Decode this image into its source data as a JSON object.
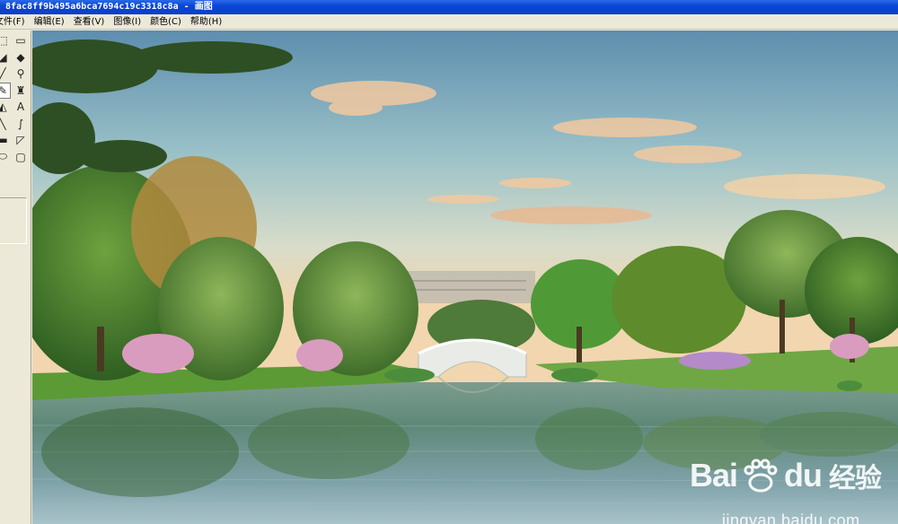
{
  "window": {
    "title": "8fac8ff9b495a6bca7694c19c3318c8a - 画图"
  },
  "menu": [
    {
      "label": "文件(F)"
    },
    {
      "label": "编辑(E)"
    },
    {
      "label": "查看(V)"
    },
    {
      "label": "图像(I)"
    },
    {
      "label": "颜色(C)"
    },
    {
      "label": "帮助(H)"
    }
  ],
  "toolbox": {
    "tools": [
      {
        "name": "free-select-icon",
        "glyph": "⬚"
      },
      {
        "name": "rect-select-icon",
        "glyph": "▭"
      },
      {
        "name": "eraser-icon",
        "glyph": "◢"
      },
      {
        "name": "fill-bucket-icon",
        "glyph": "◆"
      },
      {
        "name": "color-picker-icon",
        "glyph": "╱"
      },
      {
        "name": "magnifier-icon",
        "glyph": "⚲"
      },
      {
        "name": "pencil-icon",
        "glyph": "✎"
      },
      {
        "name": "brush-icon",
        "glyph": "♜"
      },
      {
        "name": "airbrush-icon",
        "glyph": "◭"
      },
      {
        "name": "text-icon",
        "glyph": "A"
      },
      {
        "name": "line-icon",
        "glyph": "╲"
      },
      {
        "name": "curve-icon",
        "glyph": "∫"
      },
      {
        "name": "rectangle-icon",
        "glyph": "▬"
      },
      {
        "name": "polygon-icon",
        "glyph": "◸"
      },
      {
        "name": "ellipse-icon",
        "glyph": "⬭"
      },
      {
        "name": "rounded-rect-icon",
        "glyph": "▢"
      }
    ],
    "active_tool": "pencil-icon"
  },
  "watermark": {
    "logo_text": "Bai",
    "logo_text_2": "du",
    "logo_cn": "经验",
    "url": "jingyan.baidu.com"
  },
  "colors": {
    "titlebar": "#0a46d6",
    "chrome": "#ece9d8",
    "sky_top": "#5f8fb0",
    "sky_horizon": "#f0d9b5",
    "water": "#6e8f8a",
    "foliage": "#3f7a2c"
  }
}
